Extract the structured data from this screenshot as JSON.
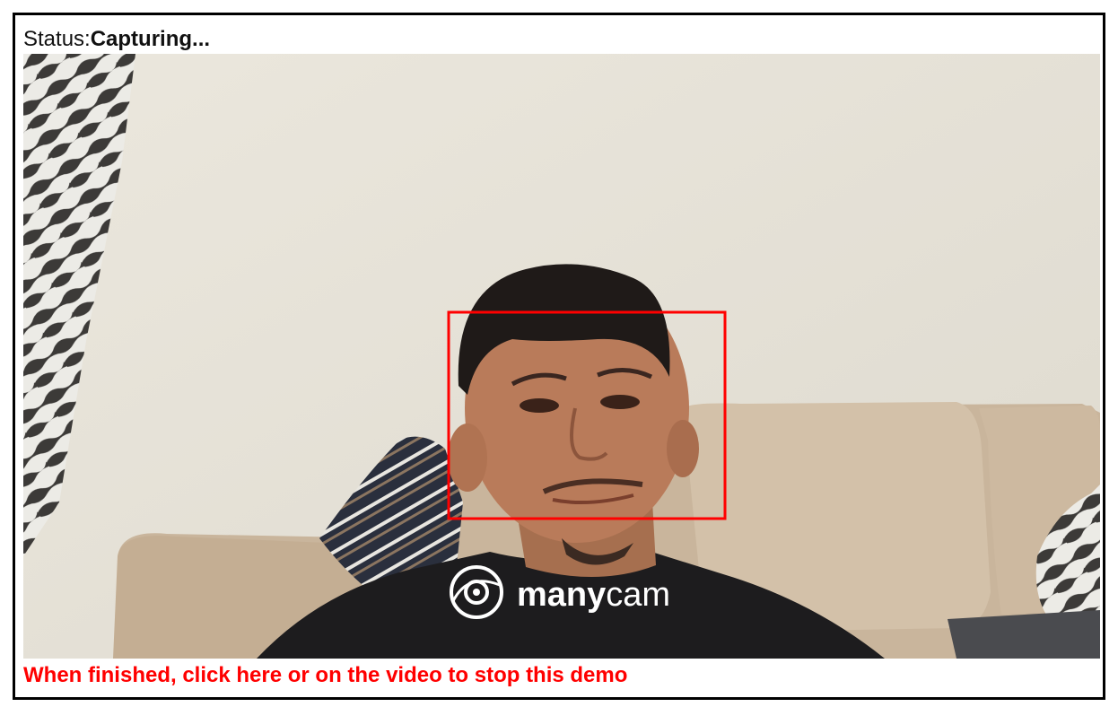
{
  "status": {
    "label": "Status:",
    "value": "Capturing..."
  },
  "video": {
    "watermark_text_bold": "many",
    "watermark_text_light": "cam",
    "watermark_icon": "manycam-eye-logo",
    "face_box_color": "#ff0000"
  },
  "footer": {
    "stop_link": "When finished, click here or on the video to stop this demo",
    "link_color": "#ff0000"
  }
}
